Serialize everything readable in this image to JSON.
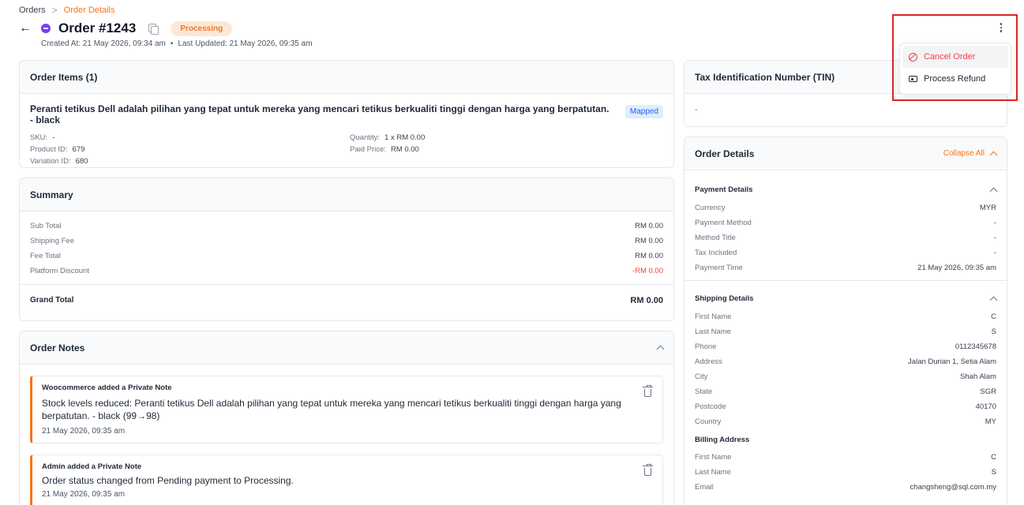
{
  "breadcrumb": {
    "root": "Orders",
    "separator": ">",
    "current": "Order Details"
  },
  "header": {
    "title": "Order #1243",
    "status": "Processing",
    "created_at": "Created At: 21 May 2026, 09:34 am",
    "bullet": "•",
    "last_updated": "Last Updated: 21 May 2026, 09:35 am"
  },
  "menu": {
    "cancel_order": "Cancel Order",
    "process_refund": "Process Refund"
  },
  "order_items": {
    "title": "Order Items (1)",
    "item": {
      "name": "Peranti tetikus Dell adalah pilihan yang tepat untuk mereka yang mencari tetikus berkualiti tinggi dengan harga yang berpatutan. - black",
      "badge": "Mapped",
      "sku_label": "SKU:",
      "sku": "-",
      "product_id_label": "Product ID:",
      "product_id": "679",
      "variation_id_label": "Variation ID:",
      "variation_id": "680",
      "quantity_label": "Quantity:",
      "quantity": "1 x RM 0.00",
      "paid_price_label": "Paid Price:",
      "paid_price": "RM 0.00"
    }
  },
  "summary": {
    "title": "Summary",
    "rows": [
      {
        "label": "Sub Total",
        "value": "RM 0.00"
      },
      {
        "label": "Shipping Fee",
        "value": "RM 0.00"
      },
      {
        "label": "Fee Total",
        "value": "RM 0.00"
      },
      {
        "label": "Platform Discount",
        "value": "-RM 0.00"
      }
    ],
    "grand_total_label": "Grand Total",
    "grand_total": "RM 0.00"
  },
  "order_notes": {
    "title": "Order Notes",
    "notes": [
      {
        "author": "Woocommerce added a Private Note",
        "text": "Stock levels reduced: Peranti tetikus Dell adalah pilihan yang tepat untuk mereka yang mencari tetikus berkualiti tinggi dengan harga yang berpatutan. - black (99→98)",
        "time": "21 May 2026, 09:35 am"
      },
      {
        "author": "Admin added a Private Note",
        "text": "Order status changed from Pending payment to Processing.",
        "time": "21 May 2026, 09:35 am"
      }
    ]
  },
  "tin": {
    "title": "Tax Identification Number (TIN)",
    "value": "-"
  },
  "order_details": {
    "title": "Order Details",
    "collapse_all": "Collapse All",
    "payment": {
      "title": "Payment Details",
      "rows": [
        {
          "label": "Currency",
          "value": "MYR"
        },
        {
          "label": "Payment Method",
          "value": "-"
        },
        {
          "label": "Method Title",
          "value": "-"
        },
        {
          "label": "Tax Included",
          "value": "-"
        },
        {
          "label": "Payment Time",
          "value": "21 May 2026, 09:35 am"
        }
      ]
    },
    "shipping": {
      "title": "Shipping Details",
      "rows": [
        {
          "label": "First Name",
          "value": "C"
        },
        {
          "label": "Last Name",
          "value": "S"
        },
        {
          "label": "Phone",
          "value": "0112345678"
        },
        {
          "label": "Address",
          "value": "Jalan Durian 1, Setia Alam"
        },
        {
          "label": "City",
          "value": "Shah Alam"
        },
        {
          "label": "State",
          "value": "SGR"
        },
        {
          "label": "Postcode",
          "value": "40170"
        },
        {
          "label": "Country",
          "value": "MY"
        }
      ]
    },
    "billing": {
      "title": "Billing Address",
      "rows": [
        {
          "label": "First Name",
          "value": "C"
        },
        {
          "label": "Last Name",
          "value": "S"
        },
        {
          "label": "Email",
          "value": "changsheng@sql.com.my"
        }
      ]
    }
  }
}
